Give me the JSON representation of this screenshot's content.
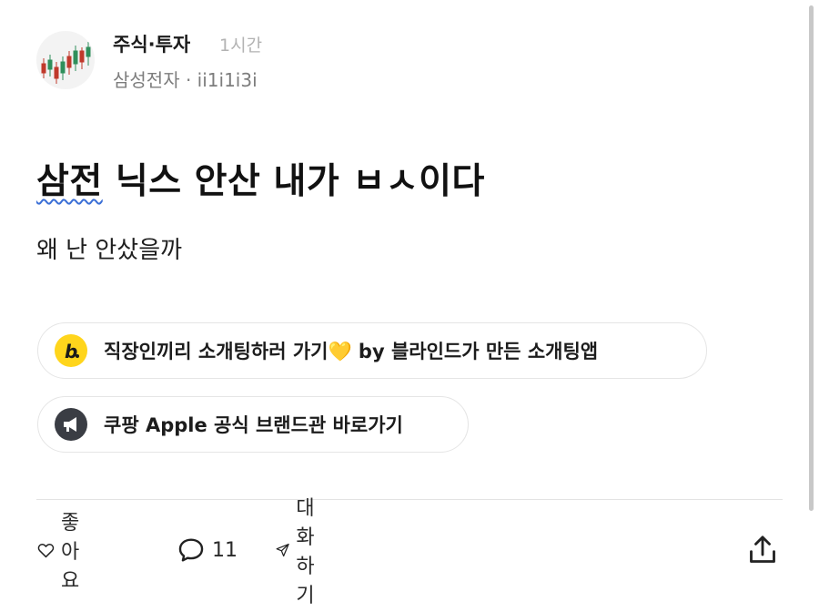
{
  "post": {
    "board": "주식·투자",
    "time": "1시간",
    "meta": "삼성전자 · ii1i1i3i",
    "title_part1": "삼전",
    "title_part2": " 닉스 안산 내가 ㅂㅅ이다",
    "body": "왜 난 안샀을까"
  },
  "ads": [
    {
      "label": "직장인끼리 소개팅하러 가기💛 by 블라인드가 만든 소개팅앱",
      "icon": "b-logo-icon"
    },
    {
      "label": "쿠팡 Apple 공식 브랜드관 바로가기",
      "icon": "megaphone-icon"
    }
  ],
  "actions": {
    "like": "좋아요",
    "comments": "11",
    "chat": "대화하기"
  },
  "colors": {
    "yellow": "#ffd51c",
    "dark_icon": "#3a3d44",
    "spell_underline": "#3b6fd6"
  }
}
